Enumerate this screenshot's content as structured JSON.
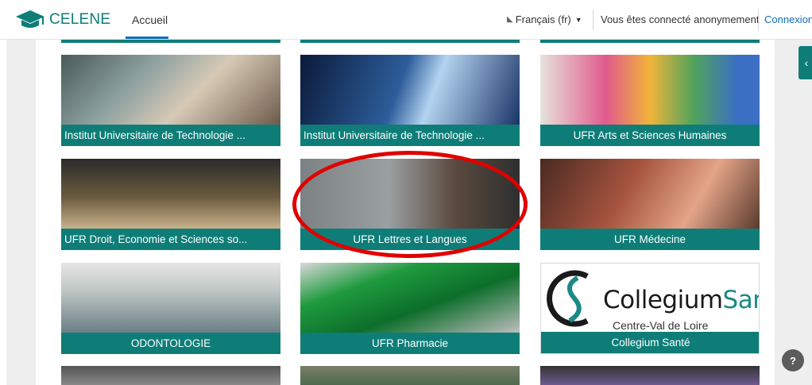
{
  "navbar": {
    "brand": "CELENE",
    "home": "Accueil",
    "language": "Français (fr)",
    "login_state": "Vous êtes connecté anonymement",
    "login_link": "Connexion"
  },
  "tiles": [
    {
      "caption": "Institut Universitaire de Technologie ...",
      "image": "digital-tablet-image"
    },
    {
      "caption": "Institut Universitaire de Technologie ...",
      "image": "robot-hand-image"
    },
    {
      "caption": "UFR Arts et Sciences Humaines",
      "image": "painted-hand-image"
    },
    {
      "caption": "UFR Droit, Economie et Sciences so...",
      "image": "gavel-scales-image"
    },
    {
      "caption": "UFR Lettres et Langues",
      "image": "woman-letters-image"
    },
    {
      "caption": "UFR Médecine",
      "image": "anatomy-image"
    },
    {
      "caption": "ODONTOLOGIE",
      "image": "dental-classroom-image"
    },
    {
      "caption": "UFR Pharmacie",
      "image": "pharmacy-cross-image"
    },
    {
      "caption": "Collegium Santé",
      "image": "collegium-logo"
    }
  ],
  "collegium_logo": {
    "part1": "Collegium",
    "part2": "Santé",
    "subtitle": "Centre-Val de Loire"
  },
  "help": "?",
  "colors": {
    "brand_teal": "#0e7d78",
    "link_blue": "#0f6cbf",
    "annotation_red": "#e00000"
  }
}
